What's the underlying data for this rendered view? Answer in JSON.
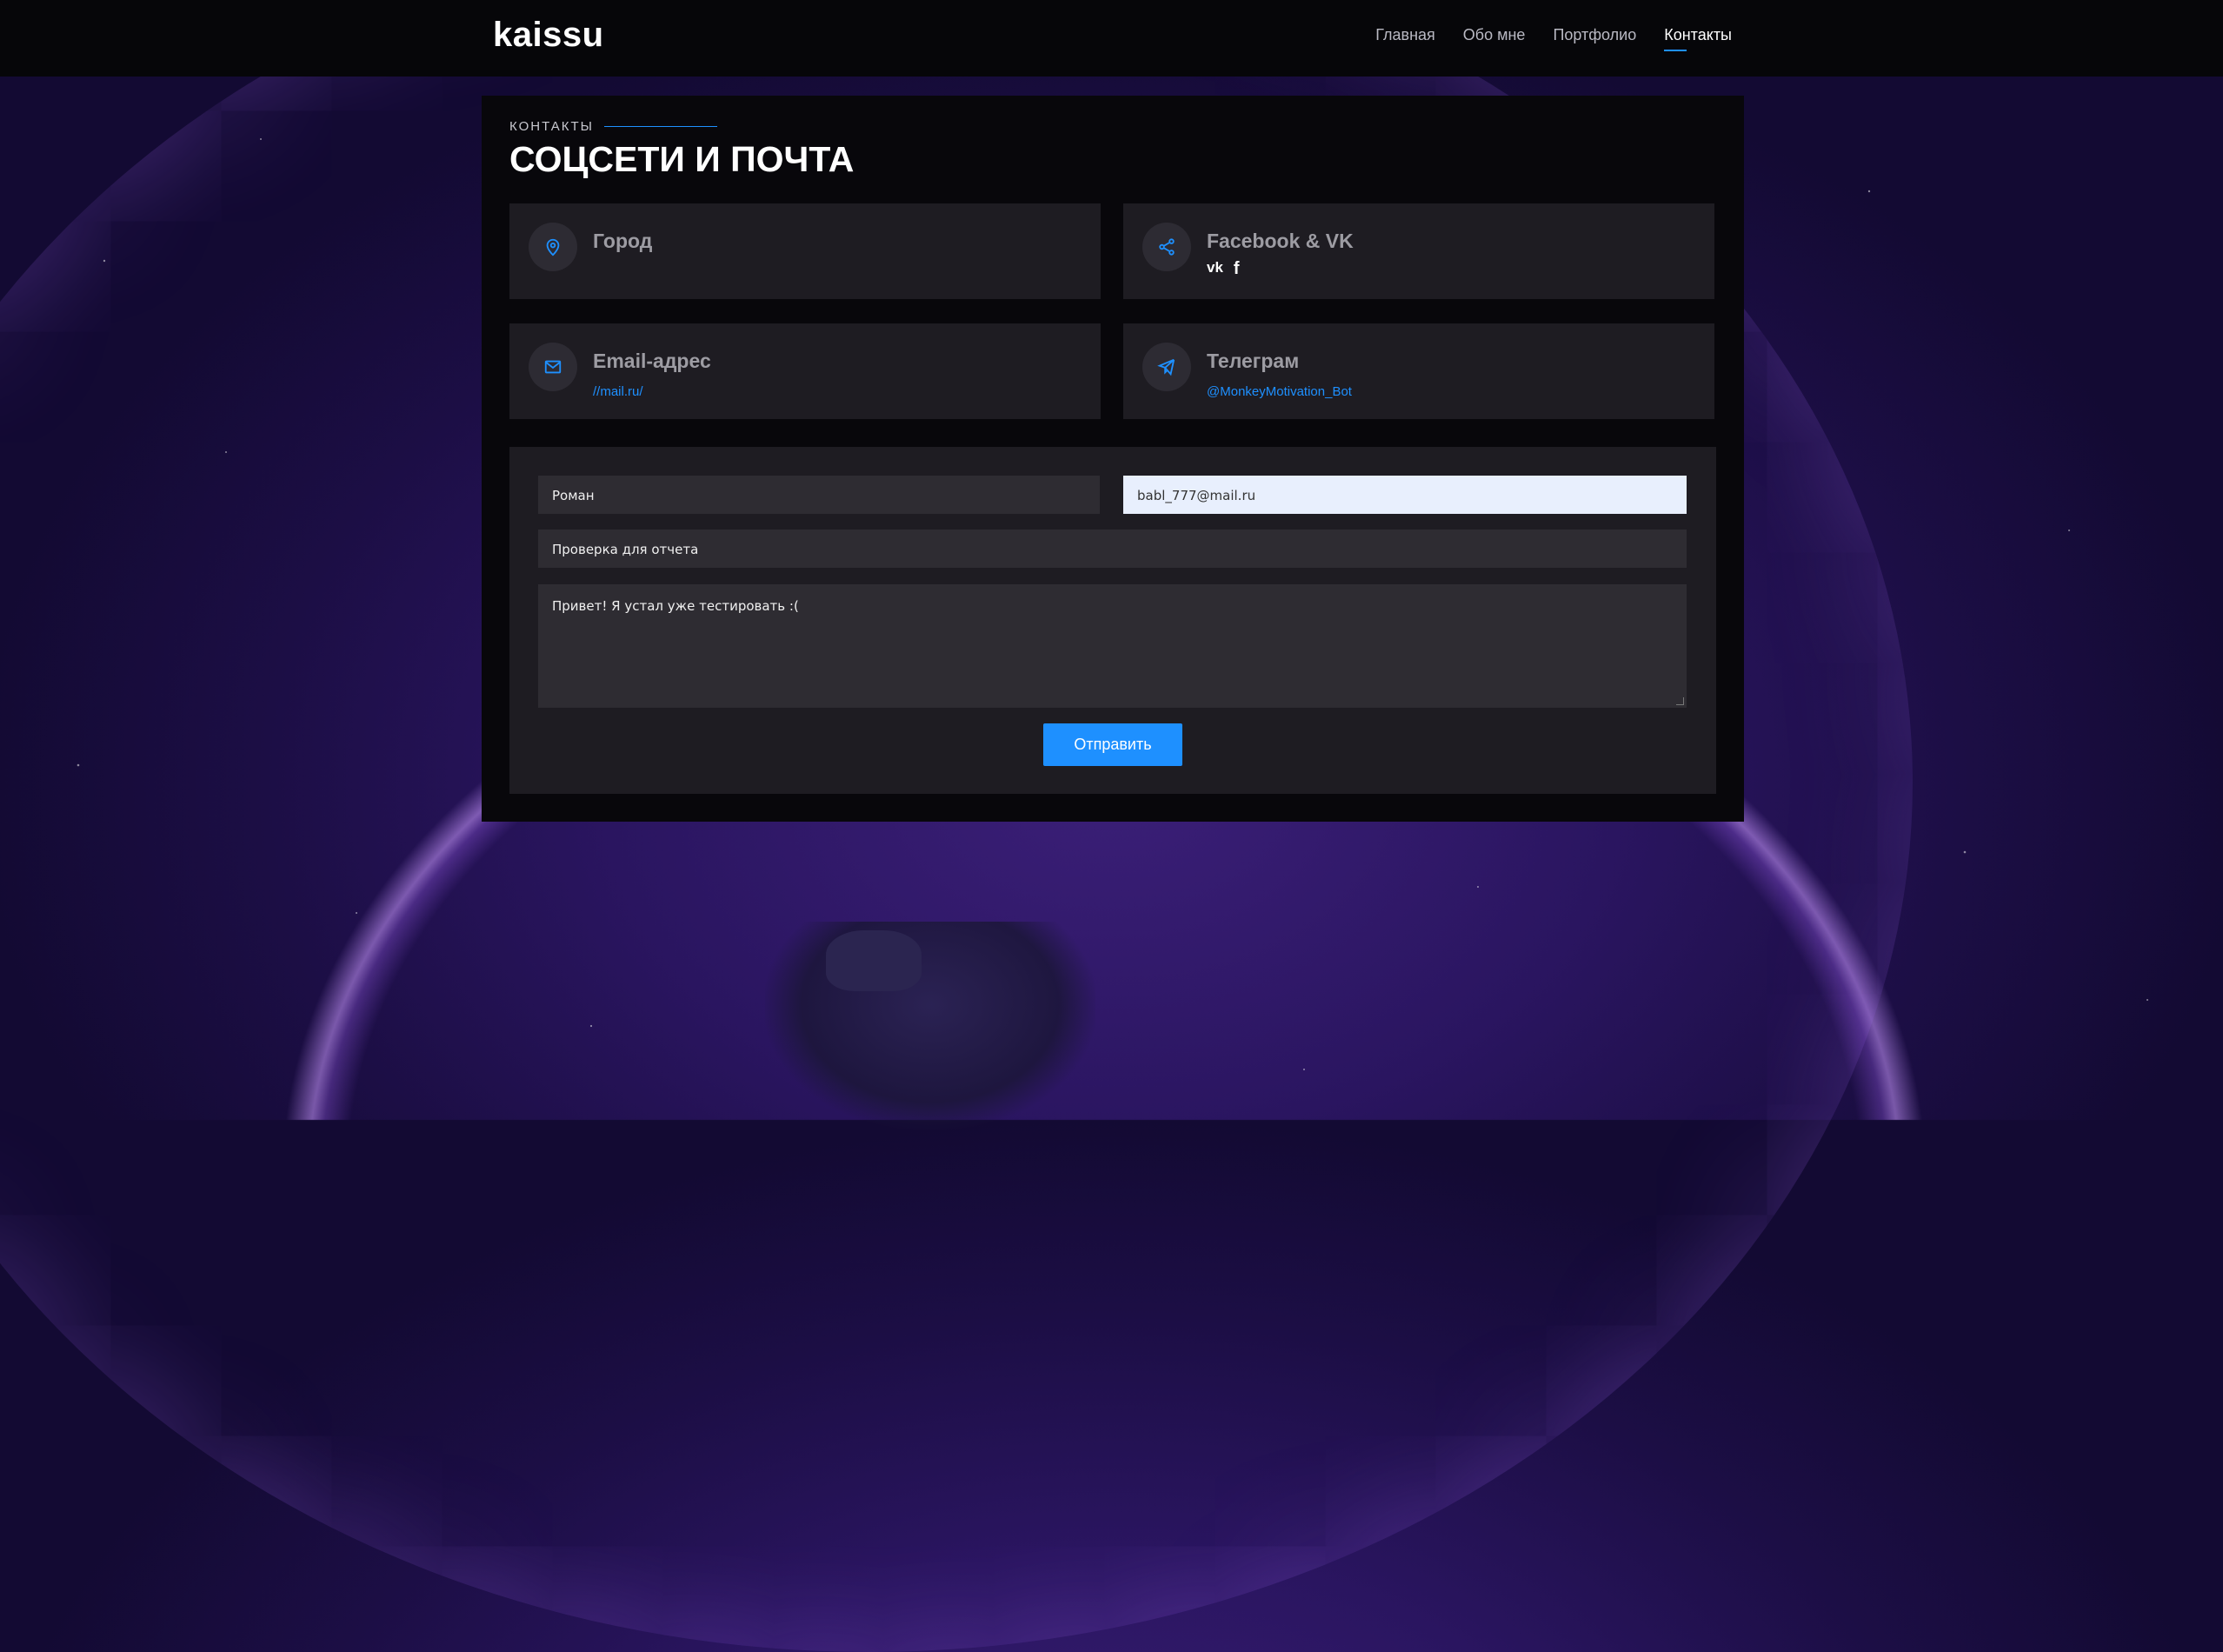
{
  "header": {
    "logo": "kaissu",
    "nav": [
      {
        "label": "Главная",
        "active": false
      },
      {
        "label": "Обо мне",
        "active": false
      },
      {
        "label": "Портфолио",
        "active": false
      },
      {
        "label": "Контакты",
        "active": true
      }
    ]
  },
  "section": {
    "label": "КОНТАКТЫ",
    "title": "СОЦСЕТИ И ПОЧТА"
  },
  "cards": {
    "city": {
      "title": "Город",
      "icon": "location-pin-icon"
    },
    "social": {
      "title": "Facebook & VK",
      "icon": "share-icon",
      "links": [
        {
          "label": "vk",
          "icon": "vk-icon"
        },
        {
          "label": "f",
          "icon": "facebook-icon"
        }
      ]
    },
    "email": {
      "title": "Email-адрес",
      "value": "//mail.ru/",
      "icon": "mail-icon"
    },
    "telegram": {
      "title": "Телеграм",
      "value": "@MonkeyMotivation_Bot",
      "icon": "telegram-icon"
    }
  },
  "form": {
    "name_value": "Роман",
    "email_value": "babl_777@mail.ru",
    "subject_value": "Проверка для отчета",
    "message_value": "Привет! Я устал уже тестировать :(",
    "submit_label": "Отправить"
  },
  "colors": {
    "accent": "#1e90ff",
    "header_bg": "#060609",
    "card_bg": "#1e1c22"
  }
}
